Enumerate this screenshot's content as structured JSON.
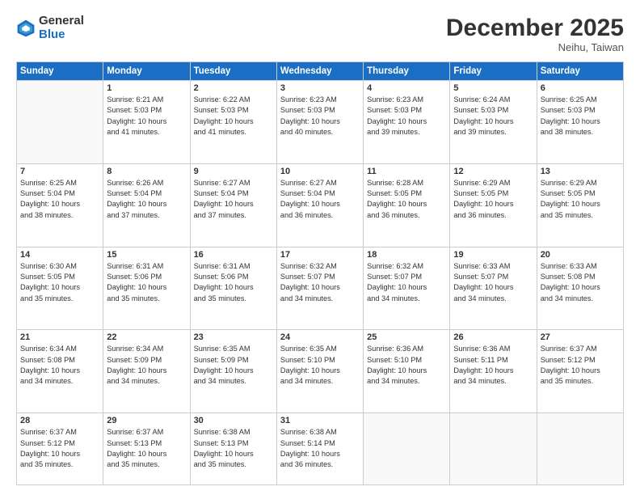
{
  "logo": {
    "general": "General",
    "blue": "Blue"
  },
  "header": {
    "month": "December 2025",
    "location": "Neihu, Taiwan"
  },
  "weekdays": [
    "Sunday",
    "Monday",
    "Tuesday",
    "Wednesday",
    "Thursday",
    "Friday",
    "Saturday"
  ],
  "weeks": [
    [
      {
        "day": "",
        "info": ""
      },
      {
        "day": "1",
        "info": "Sunrise: 6:21 AM\nSunset: 5:03 PM\nDaylight: 10 hours\nand 41 minutes."
      },
      {
        "day": "2",
        "info": "Sunrise: 6:22 AM\nSunset: 5:03 PM\nDaylight: 10 hours\nand 41 minutes."
      },
      {
        "day": "3",
        "info": "Sunrise: 6:23 AM\nSunset: 5:03 PM\nDaylight: 10 hours\nand 40 minutes."
      },
      {
        "day": "4",
        "info": "Sunrise: 6:23 AM\nSunset: 5:03 PM\nDaylight: 10 hours\nand 39 minutes."
      },
      {
        "day": "5",
        "info": "Sunrise: 6:24 AM\nSunset: 5:03 PM\nDaylight: 10 hours\nand 39 minutes."
      },
      {
        "day": "6",
        "info": "Sunrise: 6:25 AM\nSunset: 5:03 PM\nDaylight: 10 hours\nand 38 minutes."
      }
    ],
    [
      {
        "day": "7",
        "info": "Sunrise: 6:25 AM\nSunset: 5:04 PM\nDaylight: 10 hours\nand 38 minutes."
      },
      {
        "day": "8",
        "info": "Sunrise: 6:26 AM\nSunset: 5:04 PM\nDaylight: 10 hours\nand 37 minutes."
      },
      {
        "day": "9",
        "info": "Sunrise: 6:27 AM\nSunset: 5:04 PM\nDaylight: 10 hours\nand 37 minutes."
      },
      {
        "day": "10",
        "info": "Sunrise: 6:27 AM\nSunset: 5:04 PM\nDaylight: 10 hours\nand 36 minutes."
      },
      {
        "day": "11",
        "info": "Sunrise: 6:28 AM\nSunset: 5:05 PM\nDaylight: 10 hours\nand 36 minutes."
      },
      {
        "day": "12",
        "info": "Sunrise: 6:29 AM\nSunset: 5:05 PM\nDaylight: 10 hours\nand 36 minutes."
      },
      {
        "day": "13",
        "info": "Sunrise: 6:29 AM\nSunset: 5:05 PM\nDaylight: 10 hours\nand 35 minutes."
      }
    ],
    [
      {
        "day": "14",
        "info": "Sunrise: 6:30 AM\nSunset: 5:05 PM\nDaylight: 10 hours\nand 35 minutes."
      },
      {
        "day": "15",
        "info": "Sunrise: 6:31 AM\nSunset: 5:06 PM\nDaylight: 10 hours\nand 35 minutes."
      },
      {
        "day": "16",
        "info": "Sunrise: 6:31 AM\nSunset: 5:06 PM\nDaylight: 10 hours\nand 35 minutes."
      },
      {
        "day": "17",
        "info": "Sunrise: 6:32 AM\nSunset: 5:07 PM\nDaylight: 10 hours\nand 34 minutes."
      },
      {
        "day": "18",
        "info": "Sunrise: 6:32 AM\nSunset: 5:07 PM\nDaylight: 10 hours\nand 34 minutes."
      },
      {
        "day": "19",
        "info": "Sunrise: 6:33 AM\nSunset: 5:07 PM\nDaylight: 10 hours\nand 34 minutes."
      },
      {
        "day": "20",
        "info": "Sunrise: 6:33 AM\nSunset: 5:08 PM\nDaylight: 10 hours\nand 34 minutes."
      }
    ],
    [
      {
        "day": "21",
        "info": "Sunrise: 6:34 AM\nSunset: 5:08 PM\nDaylight: 10 hours\nand 34 minutes."
      },
      {
        "day": "22",
        "info": "Sunrise: 6:34 AM\nSunset: 5:09 PM\nDaylight: 10 hours\nand 34 minutes."
      },
      {
        "day": "23",
        "info": "Sunrise: 6:35 AM\nSunset: 5:09 PM\nDaylight: 10 hours\nand 34 minutes."
      },
      {
        "day": "24",
        "info": "Sunrise: 6:35 AM\nSunset: 5:10 PM\nDaylight: 10 hours\nand 34 minutes."
      },
      {
        "day": "25",
        "info": "Sunrise: 6:36 AM\nSunset: 5:10 PM\nDaylight: 10 hours\nand 34 minutes."
      },
      {
        "day": "26",
        "info": "Sunrise: 6:36 AM\nSunset: 5:11 PM\nDaylight: 10 hours\nand 34 minutes."
      },
      {
        "day": "27",
        "info": "Sunrise: 6:37 AM\nSunset: 5:12 PM\nDaylight: 10 hours\nand 35 minutes."
      }
    ],
    [
      {
        "day": "28",
        "info": "Sunrise: 6:37 AM\nSunset: 5:12 PM\nDaylight: 10 hours\nand 35 minutes."
      },
      {
        "day": "29",
        "info": "Sunrise: 6:37 AM\nSunset: 5:13 PM\nDaylight: 10 hours\nand 35 minutes."
      },
      {
        "day": "30",
        "info": "Sunrise: 6:38 AM\nSunset: 5:13 PM\nDaylight: 10 hours\nand 35 minutes."
      },
      {
        "day": "31",
        "info": "Sunrise: 6:38 AM\nSunset: 5:14 PM\nDaylight: 10 hours\nand 36 minutes."
      },
      {
        "day": "",
        "info": ""
      },
      {
        "day": "",
        "info": ""
      },
      {
        "day": "",
        "info": ""
      }
    ]
  ]
}
